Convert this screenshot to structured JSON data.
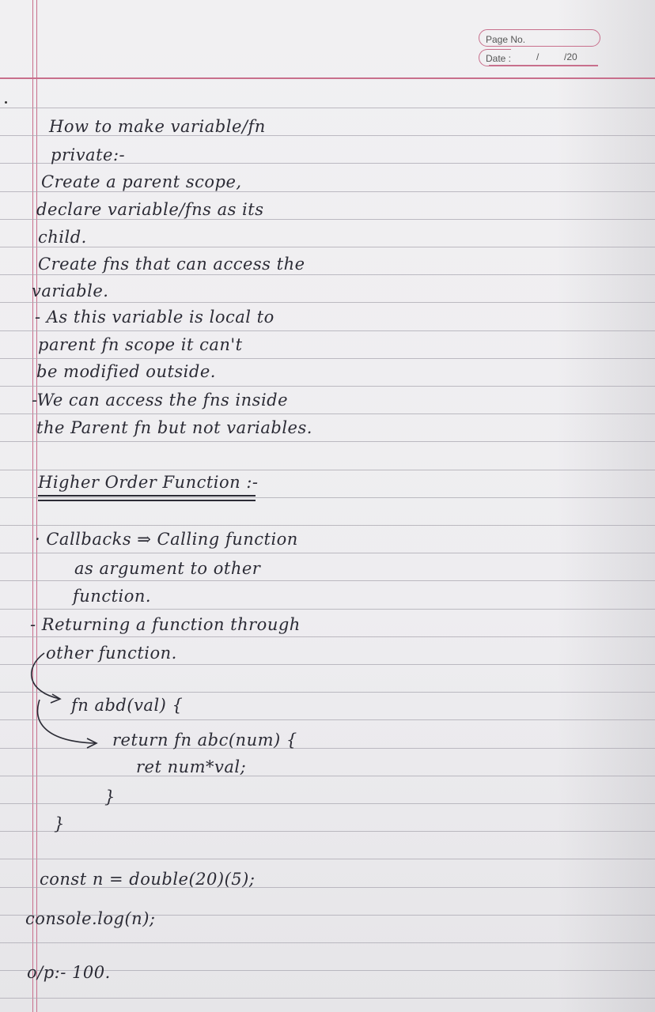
{
  "header": {
    "page_no_label": "Page No.",
    "date_label": "Date :",
    "date_slash": "/",
    "date_year": "/20"
  },
  "notes": {
    "line1": "How to make variable/fn",
    "line2": "private:-",
    "line3": "Create a parent scope,",
    "line4": "declare variable/fns as its",
    "line5": "child.",
    "line6": "Create fns that can access the",
    "line7": "variable.",
    "line8": "- As this variable is local to",
    "line9": "parent fn scope it can't",
    "line10": "be modified outside.",
    "line11": "-We can access the fns inside",
    "line12": "the Parent fn but not variables.",
    "heading": "Higher Order Function :-",
    "bullet1a": "· Callbacks ⇒ Calling function",
    "bullet1b": "as argument to other",
    "bullet1c": "function.",
    "bullet2a": "- Returning a function through",
    "bullet2b": "other function.",
    "code1": "fn abd(val) {",
    "code2": "return fn abc(num) {",
    "code3": "ret num*val;",
    "code4": "}",
    "code5": "}",
    "code6": "const n = double(20)(5);",
    "code7": "console.log(n);",
    "output": "o/p:- 100."
  }
}
